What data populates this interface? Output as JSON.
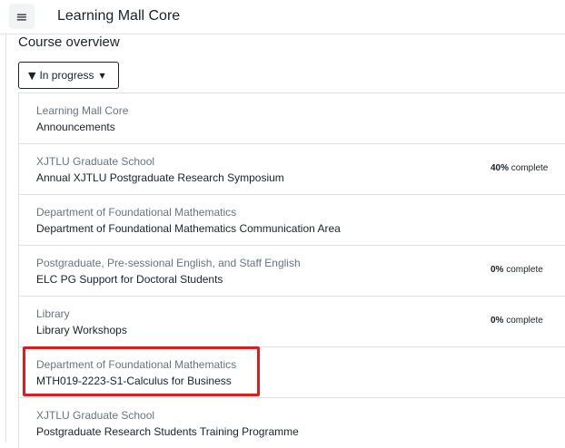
{
  "header": {
    "menu_icon": "hamburger-icon",
    "title": "Learning Mall Core"
  },
  "overview": {
    "title": "Course overview",
    "filter": {
      "icon": "filter-icon",
      "label": "In progress",
      "caret_icon": "caret-down-icon"
    }
  },
  "courses": [
    {
      "category": "Learning Mall Core",
      "name": "Announcements",
      "progress_value": "",
      "progress_suffix": ""
    },
    {
      "category": "XJTLU Graduate School",
      "name": "Annual XJTLU Postgraduate Research Symposium",
      "progress_value": "40%",
      "progress_suffix": " complete"
    },
    {
      "category": "Department of Foundational Mathematics",
      "name": "Department of Foundational Mathematics Communication Area",
      "progress_value": "",
      "progress_suffix": ""
    },
    {
      "category": "Postgraduate, Pre-sessional English, and Staff English",
      "name": "ELC PG Support for Doctoral Students",
      "progress_value": "0%",
      "progress_suffix": " complete"
    },
    {
      "category": "Library",
      "name": "Library Workshops",
      "progress_value": "0%",
      "progress_suffix": " complete"
    },
    {
      "category": "Department of Foundational Mathematics",
      "name": "MTH019-2223-S1-Calculus for Business",
      "progress_value": "",
      "progress_suffix": ""
    },
    {
      "category": "XJTLU Graduate School",
      "name": "Postgraduate Research Students Training Programme",
      "progress_value": "",
      "progress_suffix": ""
    }
  ],
  "highlight_color": "#e01b1b"
}
